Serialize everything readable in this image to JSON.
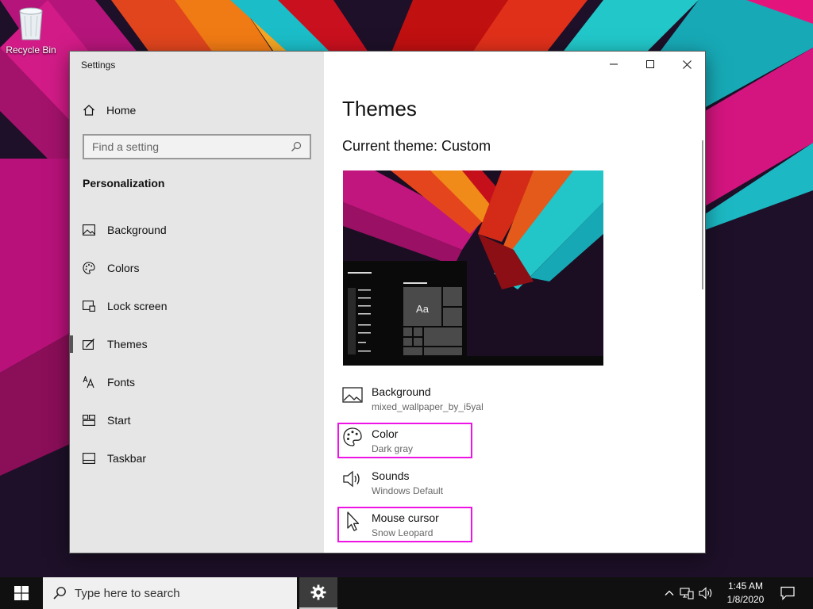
{
  "desktop": {
    "recycle_bin_label": "Recycle Bin"
  },
  "settings_window": {
    "title": "Settings",
    "sidebar": {
      "home_label": "Home",
      "search_placeholder": "Find a setting",
      "section_title": "Personalization",
      "items": [
        {
          "label": "Background",
          "icon": "image-icon",
          "active": false
        },
        {
          "label": "Colors",
          "icon": "palette-icon",
          "active": false
        },
        {
          "label": "Lock screen",
          "icon": "lock-screen-icon",
          "active": false
        },
        {
          "label": "Themes",
          "icon": "brush-icon",
          "active": true
        },
        {
          "label": "Fonts",
          "icon": "font-icon",
          "active": false
        },
        {
          "label": "Start",
          "icon": "start-icon",
          "active": false
        },
        {
          "label": "Taskbar",
          "icon": "taskbar-icon",
          "active": false
        }
      ]
    },
    "content": {
      "page_title": "Themes",
      "current_theme": "Current theme: Custom",
      "preview_tile_text": "Aa",
      "theme_items": [
        {
          "name": "Background",
          "value": "mixed_wallpaper_by_i5yal",
          "icon": "image-icon",
          "highlighted": false
        },
        {
          "name": "Color",
          "value": "Dark gray",
          "icon": "palette-icon",
          "highlighted": true
        },
        {
          "name": "Sounds",
          "value": "Windows Default",
          "icon": "speaker-icon",
          "highlighted": false
        },
        {
          "name": "Mouse cursor",
          "value": "Snow Leopard",
          "icon": "cursor-icon",
          "highlighted": true
        }
      ]
    }
  },
  "taskbar": {
    "search_placeholder": "Type here to search",
    "time": "1:45 AM",
    "date": "1/8/2020"
  },
  "colors": {
    "highlight": "#ee14e6",
    "sidebar_bg": "#e6e6e6",
    "taskbar_bg": "#101010"
  }
}
